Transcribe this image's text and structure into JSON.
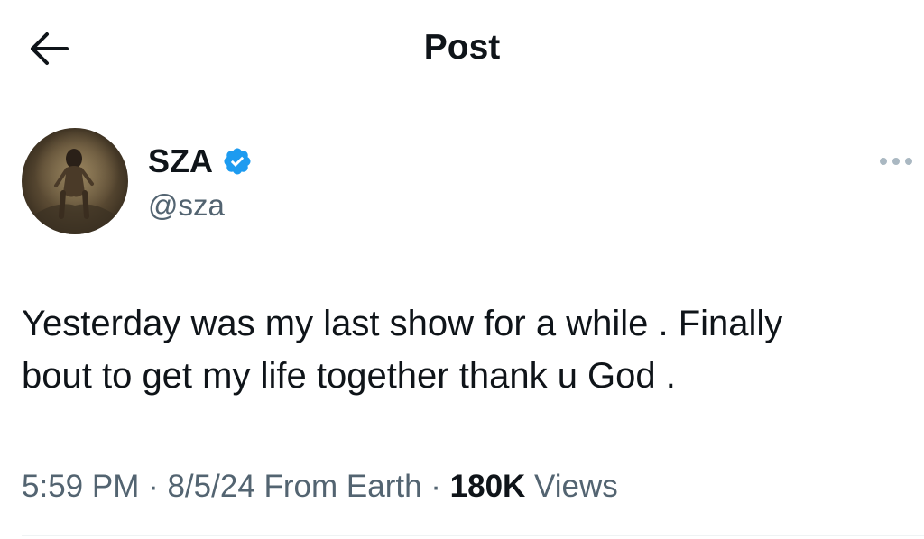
{
  "header": {
    "title": "Post",
    "back_icon": "arrow-left-icon"
  },
  "author": {
    "display_name": "SZA",
    "handle": "@sza",
    "verified": true,
    "verified_icon": "verified-badge-icon",
    "avatar_icon": "avatar-photo"
  },
  "more_icon": "more-horizontal-icon",
  "post": {
    "text": "Yesterday was my last show for a while . Finally\nbout to get my life together thank u God ."
  },
  "meta": {
    "time": "5:59 PM",
    "sep1": " · ",
    "date": "8/5/24",
    "source": " From Earth",
    "sep2": " · ",
    "views_count": "180K",
    "views_label": " Views"
  },
  "colors": {
    "text_primary": "#0f1419",
    "text_secondary": "#536471",
    "verified_blue": "#1d9bf0",
    "more_icon_gray": "#aab8c2",
    "divider": "#eff3f4"
  }
}
